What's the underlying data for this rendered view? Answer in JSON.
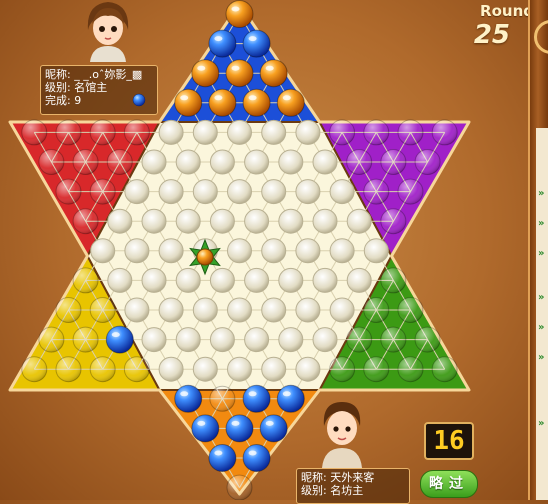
{
  "round": {
    "label": "Round",
    "value": "25"
  },
  "top_player": {
    "nickname": "昵称: _ _.oˆ妳影_▩",
    "level": "级别: 名馆主",
    "progress": "完成: 9",
    "color": "#f28a10"
  },
  "bottom_player": {
    "nickname": "昵称: 天外来客",
    "level": "级别: 名坊主",
    "color": "#1c4fd8"
  },
  "timer": "16",
  "skip_button": "略过",
  "colors": {
    "red": "#d8282a",
    "purple": "#a020c8",
    "green": "#3c9a14",
    "yellow": "#e8c400",
    "blue": "#1c4fd8",
    "orange": "#f28a10",
    "center": "#fbf6dc"
  },
  "board": {
    "pieces": [
      {
        "color": "orange",
        "row": 0,
        "col": 0
      },
      {
        "color": "orange",
        "row": 2,
        "col": 0
      },
      {
        "color": "orange",
        "row": 2,
        "col": 1
      },
      {
        "color": "orange",
        "row": 2,
        "col": 2
      },
      {
        "color": "orange",
        "row": 3,
        "col": 0
      },
      {
        "color": "orange",
        "row": 3,
        "col": 1
      },
      {
        "color": "orange",
        "row": 3,
        "col": 2
      },
      {
        "color": "orange",
        "row": 3,
        "col": 3
      },
      {
        "color": "blue",
        "row": 1,
        "col": 0
      },
      {
        "color": "blue",
        "row": 1,
        "col": 1
      },
      {
        "color": "blue",
        "row": 17,
        "col": 0
      },
      {
        "color": "blue",
        "row": 17,
        "col": 2
      },
      {
        "color": "blue",
        "row": 17,
        "col": 3
      },
      {
        "color": "blue",
        "row": 18,
        "col": 0
      },
      {
        "color": "blue",
        "row": 18,
        "col": 1
      },
      {
        "color": "blue",
        "row": 18,
        "col": 2
      },
      {
        "color": "blue",
        "row": 19,
        "col": 0
      },
      {
        "color": "blue",
        "row": 19,
        "col": 1
      },
      {
        "color": "blue",
        "row": 13,
        "col": 2
      }
    ],
    "selected": {
      "row": 10,
      "col": 3
    }
  }
}
